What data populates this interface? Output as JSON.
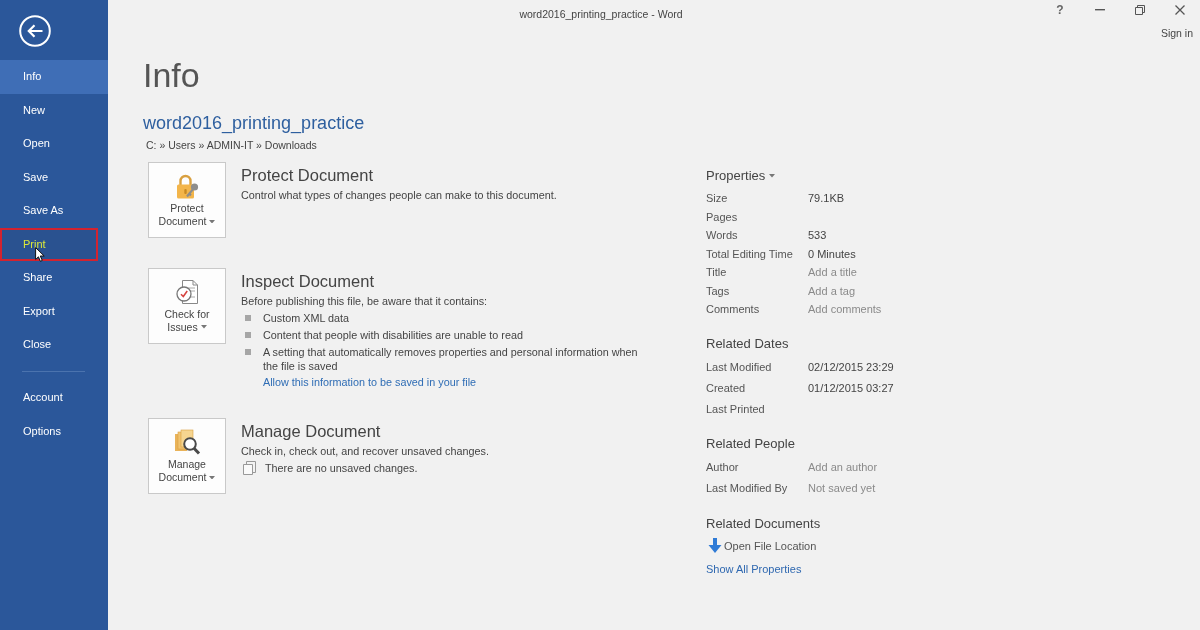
{
  "window": {
    "title": "word2016_printing_practice - Word",
    "help": "?",
    "sign_in": "Sign in"
  },
  "nav": {
    "items": [
      {
        "label": "Info",
        "selected": true,
        "highlighted": false
      },
      {
        "label": "New",
        "selected": false,
        "highlighted": false
      },
      {
        "label": "Open",
        "selected": false,
        "highlighted": false
      },
      {
        "label": "Save",
        "selected": false,
        "highlighted": false
      },
      {
        "label": "Save As",
        "selected": false,
        "highlighted": false
      },
      {
        "label": "Print",
        "selected": false,
        "highlighted": true
      },
      {
        "label": "Share",
        "selected": false,
        "highlighted": false
      },
      {
        "label": "Export",
        "selected": false,
        "highlighted": false
      },
      {
        "label": "Close",
        "selected": false,
        "highlighted": false
      }
    ],
    "footer_items": [
      {
        "label": "Account",
        "selected": false,
        "highlighted": false
      },
      {
        "label": "Options",
        "selected": false,
        "highlighted": false
      }
    ]
  },
  "page": {
    "heading": "Info",
    "document_name": "word2016_printing_practice",
    "path": "C: » Users » ADMIN-IT » Downloads"
  },
  "sections": [
    {
      "kind": "protect",
      "button_label": "Protect Document",
      "title": "Protect Document",
      "description": "Control what types of changes people can make to this document."
    },
    {
      "kind": "inspect",
      "button_label": "Check for Issues",
      "title": "Inspect Document",
      "description": "Before publishing this file, be aware that it contains:",
      "bullets": [
        "Custom XML data",
        "Content that people with disabilities are unable to read",
        "A setting that automatically removes properties and personal information when the file is saved"
      ],
      "link": "Allow this information to be saved in your file"
    },
    {
      "kind": "manage",
      "button_label": "Manage Document",
      "title": "Manage Document",
      "description": "Check in, check out, and recover unsaved changes.",
      "note": "There are no unsaved changes."
    }
  ],
  "properties": {
    "title": "Properties",
    "rows": [
      {
        "label": "Size",
        "value": "79.1KB",
        "dimmed": false
      },
      {
        "label": "Pages"
      },
      {
        "label": "Words",
        "value": "533",
        "dimmed": false
      },
      {
        "label": "Total Editing Time",
        "value": "0 Minutes",
        "dimmed": false
      },
      {
        "label": "Title",
        "placeholder": "Add a title"
      },
      {
        "label": "Tags",
        "placeholder": "Add a tag"
      },
      {
        "label": "Comments",
        "placeholder": "Add comments"
      }
    ]
  },
  "related_dates": {
    "title": "Related Dates",
    "rows": [
      {
        "label": "Last Modified",
        "value": "02/12/2015 23:29",
        "dimmed": false
      },
      {
        "label": "Created",
        "value": "01/12/2015 03:27",
        "dimmed": false
      },
      {
        "label": "Last Printed"
      }
    ]
  },
  "related_people": {
    "title": "Related People",
    "rows": [
      {
        "label": "Author",
        "placeholder": "Add an author"
      },
      {
        "label": "Last Modified By",
        "value": "Not saved yet",
        "dimmed": true
      }
    ]
  },
  "related_documents": {
    "title": "Related Documents",
    "items": [
      {
        "kind": "location",
        "label": "Open File Location"
      },
      {
        "kind": "link",
        "label": "Show All Properties"
      }
    ]
  }
}
